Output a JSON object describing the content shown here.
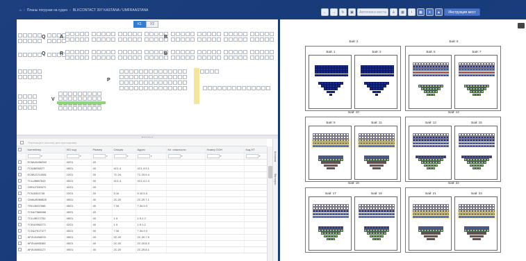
{
  "breadcrumb": {
    "home_icon": "home-icon",
    "items": [
      "Планы погрузки на судно",
      "BLKCONTACT 397 KASTANA / UMFRAASTANA"
    ]
  },
  "toolbar": {
    "search_placeholder": "Автопоиск места",
    "help_label": "Инструкция мест",
    "icons": [
      "arrow-left-icon",
      "arrow-right-icon",
      "refresh-icon",
      "save-icon",
      "person-icon",
      "grid-icon",
      "info-icon",
      "grid-view-icon",
      "list-view-icon",
      "lock-icon"
    ]
  },
  "view_switch": {
    "a": "К1",
    "b": "У2"
  },
  "tier_letters": [
    "Q",
    "A",
    "B",
    "Q",
    "R",
    "B",
    "P",
    "V"
  ],
  "group_hint": "Перетащите колонку для группировки",
  "table": {
    "columns": [
      "",
      "Контейнер",
      "ISO код",
      "Размер",
      "Секция",
      "Адрес",
      "Кл. опасности",
      "Номер ООН",
      "Код НТ"
    ],
    "rows": [
      [
        "ECMU5456283",
        "42G1",
        "40",
        "",
        ""
      ],
      [
        "FCIU8036577",
        "45G1",
        "40",
        "4С1.4",
        "4С1.4.9.1"
      ],
      [
        "ECMU2213381",
        "22G1",
        "20",
        "7С.24",
        "7С.24.5.4"
      ],
      [
        "TCLU8887643",
        "45G1",
        "40",
        "4С1.4",
        "4С1.4.2.4"
      ],
      [
        "CBSU7332672",
        "42G1",
        "40",
        "",
        ""
      ],
      [
        "FCIU5342745",
        "22G1",
        "20",
        "5.10",
        "5.10.5.3"
      ],
      [
        "CMAU8085828",
        "45G1",
        "40",
        "2С.20",
        "2С.20.7.1"
      ],
      [
        "TRLU5437566",
        "45G1",
        "40",
        "7.34",
        "7.34.9.3"
      ],
      [
        "TCNU7566566",
        "45G1",
        "40",
        "",
        ""
      ],
      [
        "TCLU6072752",
        "45G1",
        "40",
        "1.9",
        "1.9.1.2"
      ],
      [
        "TCKU0952271",
        "42G1",
        "40",
        "1.9",
        "1.9.1.2"
      ],
      [
        "TCNU7917377",
        "45G1",
        "40",
        "7.34",
        "7.34.9.3"
      ],
      [
        "APZU3456578",
        "45G1",
        "40",
        "2С.20",
        "2С.20.7.5"
      ],
      [
        "APZU4895382",
        "45G1",
        "40",
        "2С.20",
        "2С.20.8.3"
      ],
      [
        "APZU4881127",
        "45G1",
        "40",
        "2С.20",
        "2С.20.8.1"
      ]
    ]
  },
  "side_tabs": [
    "Колонки",
    "Фильтры"
  ],
  "bays": {
    "groups": [
      {
        "header": "Бай: 2",
        "cards": [
          "Бай: 1",
          "Бай: 3"
        ]
      },
      {
        "header": "Бай: 6",
        "cards": [
          "Бай: 5",
          "Бай: 7"
        ]
      },
      {
        "header": "Бай: 10",
        "cards": [
          "Бай: 9",
          "Бай: 11"
        ]
      },
      {
        "header": "Бай: 14",
        "cards": [
          "Бай: 13",
          "Бай: 15"
        ]
      },
      {
        "header": "Бай: 18",
        "cards": [
          "Бай: 17",
          "Бай: 19"
        ]
      },
      {
        "header": "Бай: 22",
        "cards": [
          "Бай: 21",
          "Бай: 23"
        ]
      }
    ]
  },
  "colors": {
    "navy": "#1b2f9e",
    "red": "#d9342b",
    "green": "#7ed957",
    "yellow": "#f2df62",
    "brown": "#7a4a2a",
    "blue": "#2f5fd0",
    "highlight": "#f3e59a"
  }
}
